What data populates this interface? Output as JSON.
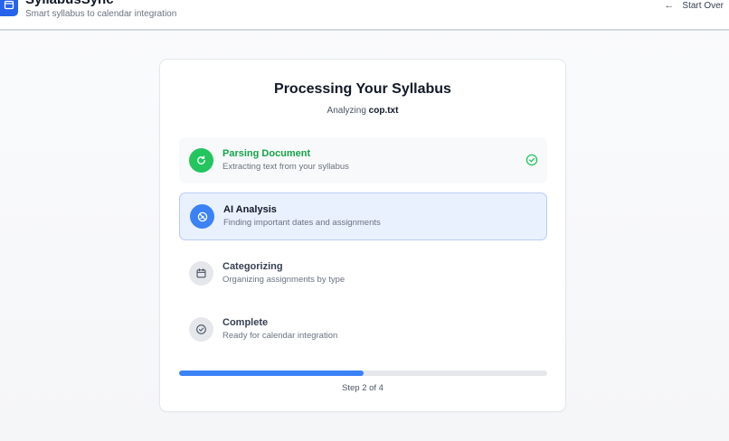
{
  "app": {
    "title": "SyllabusSync",
    "subtitle": "Smart syllabus to calendar integration",
    "start_over_label": "Start Over"
  },
  "card": {
    "title": "Processing Your Syllabus",
    "analyzing_prefix": "Analyzing",
    "filename": "cop.txt"
  },
  "steps": [
    {
      "title": "Parsing Document",
      "description": "Extracting text from your syllabus",
      "status": "done",
      "icon": "refresh-icon"
    },
    {
      "title": "AI Analysis",
      "description": "Finding important dates and assignments",
      "status": "active",
      "icon": "brain-icon"
    },
    {
      "title": "Categorizing",
      "description": "Organizing assignments by type",
      "status": "pending",
      "icon": "calendar-icon"
    },
    {
      "title": "Complete",
      "description": "Ready for calendar integration",
      "status": "pending",
      "icon": "check-circle-icon"
    }
  ],
  "progress": {
    "fraction": 0.5,
    "label": "Step 2 of 4"
  },
  "colors": {
    "accent": "#3b82f6",
    "success": "#22c55e",
    "brand": "#2563eb"
  }
}
